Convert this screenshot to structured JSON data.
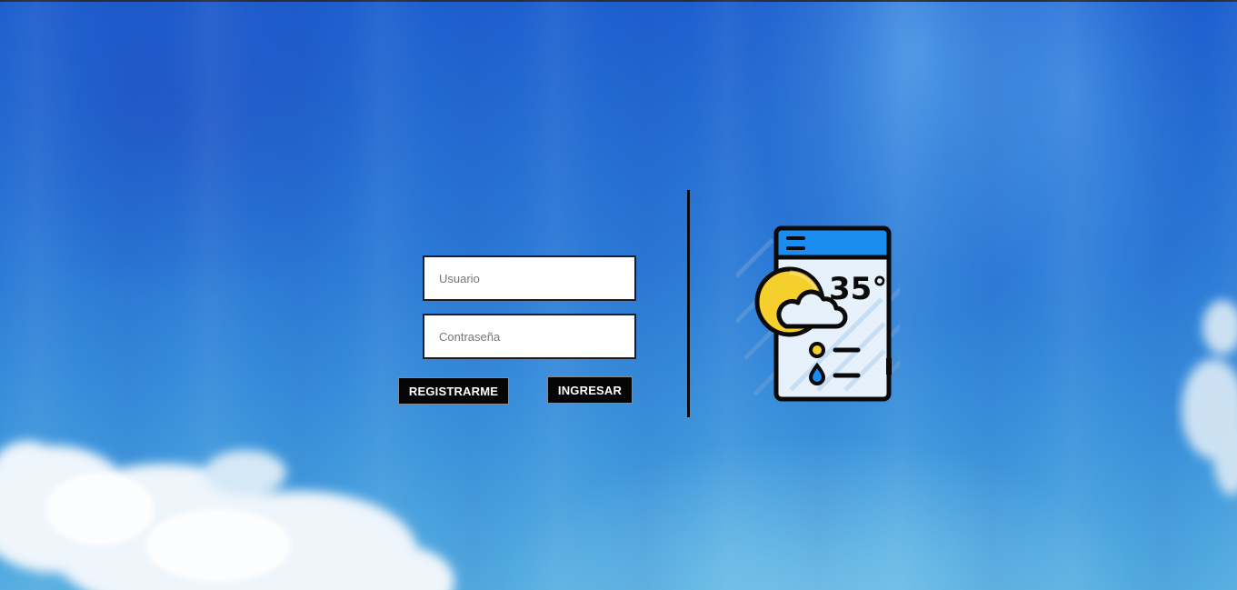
{
  "login": {
    "username_placeholder": "Usuario",
    "password_placeholder": "Contraseña",
    "register_label": "REGISTRARME",
    "login_label": "INGRESAR"
  },
  "logo": {
    "icon": "weather-app-icon",
    "temperature_text": "35°"
  },
  "colors": {
    "sky": "#2b7ad6",
    "button_bg": "#050505",
    "button_text": "#ffffff",
    "divider": "#0a0a0a",
    "sun": "#f5cf2b",
    "phone_header": "#1a8cf0"
  }
}
